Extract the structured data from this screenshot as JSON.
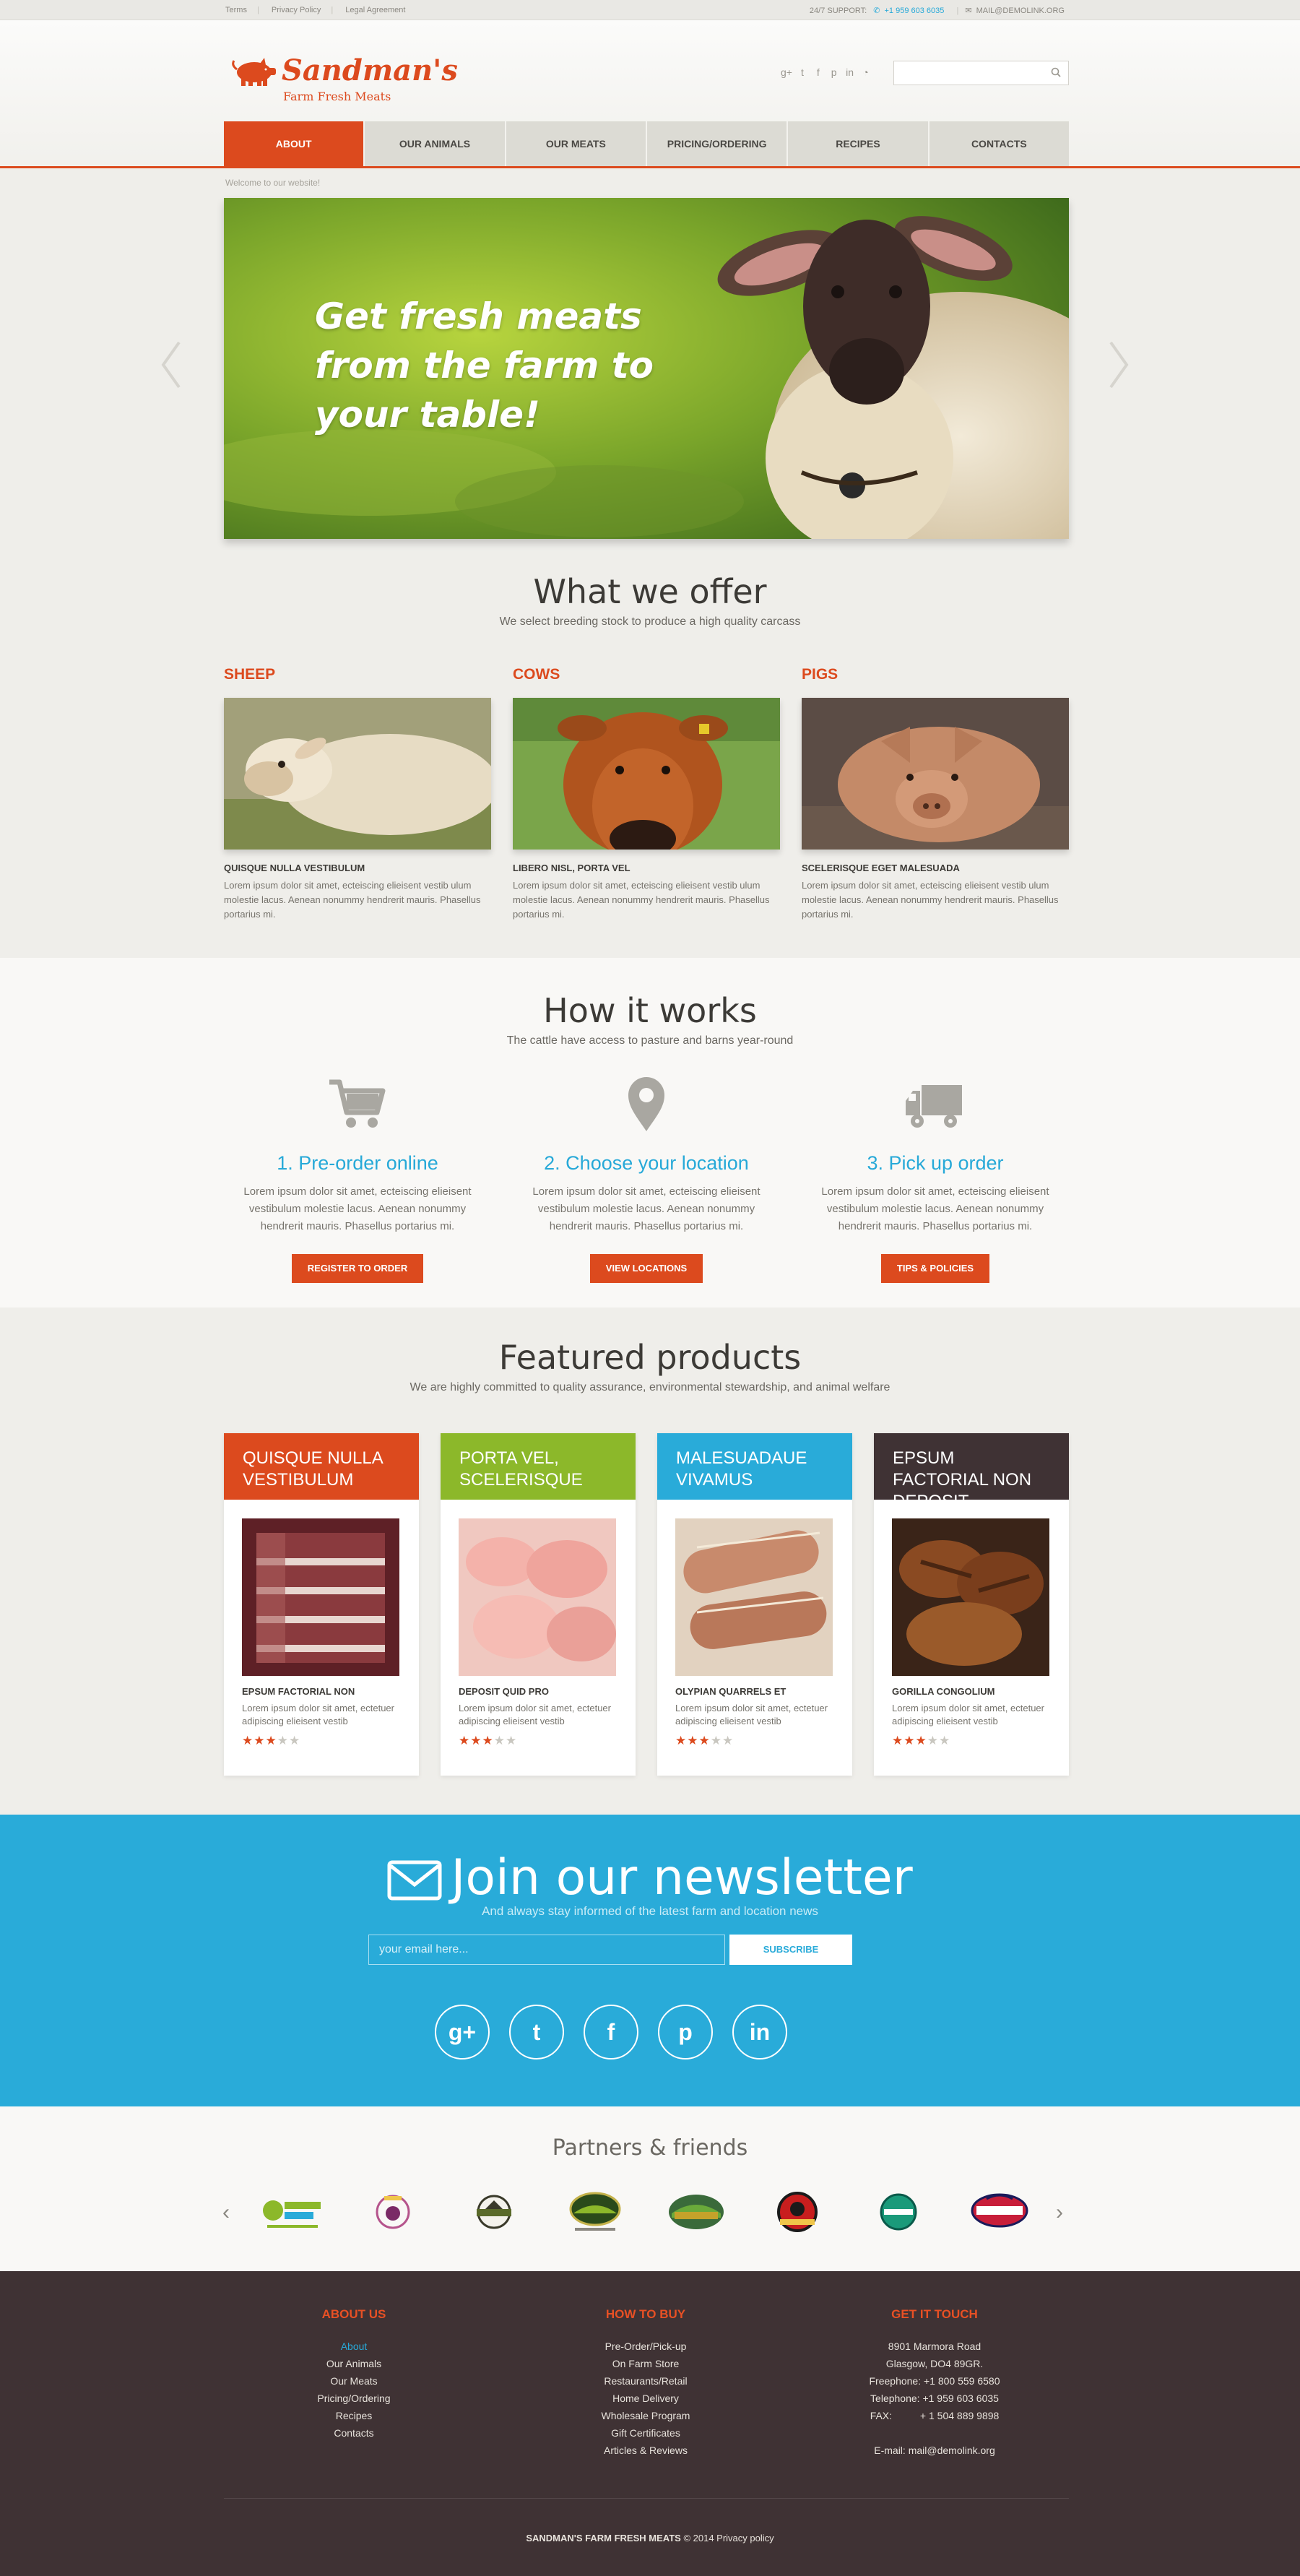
{
  "topbar": {
    "links": [
      "Terms",
      "Privacy Policy",
      "Legal Agreement"
    ],
    "support_label": "24/7 SUPPORT:",
    "phone": "+1 959 603 6035",
    "email": "MAIL@DEMOLINK.ORG"
  },
  "header": {
    "logo_name": "Sandman's",
    "logo_tagline": "Farm Fresh Meats",
    "search_placeholder": ""
  },
  "nav": {
    "items": [
      "ABOUT",
      "OUR ANIMALS",
      "OUR MEATS",
      "PRICING/ORDERING",
      "RECIPES",
      "CONTACTS"
    ],
    "active": "ABOUT"
  },
  "welcome": "Welcome to our website!",
  "hero": {
    "line1": "Get fresh meats",
    "line2": "from the farm to",
    "line3": "your table!"
  },
  "offer": {
    "title": "What we offer",
    "subtitle": "We select breeding stock to produce a high quality carcass",
    "items": [
      {
        "title": "SHEEP",
        "subtitle": "QUISQUE NULLA VESTIBULUM",
        "text": "Lorem ipsum dolor sit amet, ecteiscing elieisent vestib ulum molestie lacus. Aenean nonummy hendrerit mauris. Phasellus portarius mi."
      },
      {
        "title": "COWS",
        "subtitle": "LIBERO NISL, PORTA VEL",
        "text": "Lorem ipsum dolor sit amet, ecteiscing elieisent vestib ulum molestie lacus. Aenean nonummy hendrerit mauris. Phasellus portarius mi."
      },
      {
        "title": "PIGS",
        "subtitle": "SCELERISQUE EGET MALESUADA",
        "text": "Lorem ipsum dolor sit amet, ecteiscing elieisent vestib ulum molestie lacus. Aenean nonummy hendrerit mauris. Phasellus portarius mi."
      }
    ]
  },
  "how": {
    "title": "How it works",
    "subtitle": "The cattle have access to pasture and barns year-round",
    "steps": [
      {
        "title": "1. Pre-order online",
        "text": "Lorem ipsum dolor sit amet, ecteiscing elieisent vestibulum molestie lacus. Aenean nonummy hendrerit mauris. Phasellus portarius mi.",
        "button": "REGISTER TO ORDER",
        "icon": "cart-icon"
      },
      {
        "title": "2. Choose your location",
        "text": "Lorem ipsum dolor sit amet, ecteiscing elieisent vestibulum molestie lacus. Aenean nonummy hendrerit mauris. Phasellus portarius mi.",
        "button": "VIEW LOCATIONS",
        "icon": "map-pin-icon"
      },
      {
        "title": "3. Pick up order",
        "text": "Lorem ipsum dolor sit amet, ecteiscing elieisent vestibulum molestie lacus. Aenean nonummy hendrerit mauris. Phasellus portarius mi.",
        "button": "TIPS & POLICIES",
        "icon": "truck-icon"
      }
    ]
  },
  "featured": {
    "title": "Featured products",
    "subtitle": "We are highly committed to quality assurance, environmental stewardship, and animal welfare",
    "products": [
      {
        "header": "QUISQUE NULLA VESTIBULUM",
        "color": "#dc4a1e",
        "name": "EPSUM FACTORIAL NON",
        "text": "Lorem ipsum dolor sit amet, ectetuer adipiscing elieisent vestib",
        "rating": 3
      },
      {
        "header": "PORTA VEL, SCELERISQUE",
        "color": "#8cb82a",
        "name": "DEPOSIT QUID PRO",
        "text": "Lorem ipsum dolor sit amet, ectetuer adipiscing elieisent vestib",
        "rating": 3
      },
      {
        "header": "MALESUADAUE VIVAMUS",
        "color": "#29abd9",
        "name": "OLYPIAN QUARRELS ET",
        "text": "Lorem ipsum dolor sit amet, ectetuer adipiscing elieisent vestib",
        "rating": 3
      },
      {
        "header": "EPSUM FACTORIAL NON DEPOSIT",
        "color": "#3f3234",
        "name": "GORILLA CONGOLIUM",
        "text": "Lorem ipsum dolor sit amet, ectetuer adipiscing elieisent vestib",
        "rating": 3
      }
    ]
  },
  "newsletter": {
    "title": "Join our newsletter",
    "subtitle": "And always stay informed of the latest farm and location news",
    "placeholder": "your email here...",
    "button": "SUBSCRIBE",
    "social": [
      "g+",
      "twitter",
      "facebook",
      "pinterest",
      "linkedin"
    ]
  },
  "partners": {
    "title": "Partners & friends",
    "logos": [
      "Farm Fresh",
      "Nathan Farms",
      "Ranch",
      "Monka Craft Farm",
      "Canadian Farm",
      "Superfarm",
      "Fresh Farm",
      "Hodges"
    ]
  },
  "footer": {
    "col1": {
      "head": "ABOUT US",
      "links": [
        "About",
        "Our Animals",
        "Our Meats",
        "Pricing/Ordering",
        "Recipes",
        "Contacts"
      ]
    },
    "col2": {
      "head": "HOW TO BUY",
      "links": [
        "Pre-Order/Pick-up",
        "On Farm Store",
        "Restaurants/Retail",
        "Home Delivery",
        "Wholesale Program",
        "Gift Certificates",
        "Articles & Reviews"
      ]
    },
    "col3": {
      "head": "GET IT TOUCH",
      "lines": [
        "8901 Marmora Road",
        "Glasgow, DO4 89GR.",
        "Freephone:  +1 800 559 6580",
        "Telephone:  +1 959 603 6035",
        "FAX:          + 1 504 889 9898",
        "",
        "E-mail: mail@demolink.org"
      ]
    },
    "copyright_brand": "SANDMAN'S FARM FRESH MEATS",
    "copyright_rest": "© 2014 Privacy policy"
  }
}
